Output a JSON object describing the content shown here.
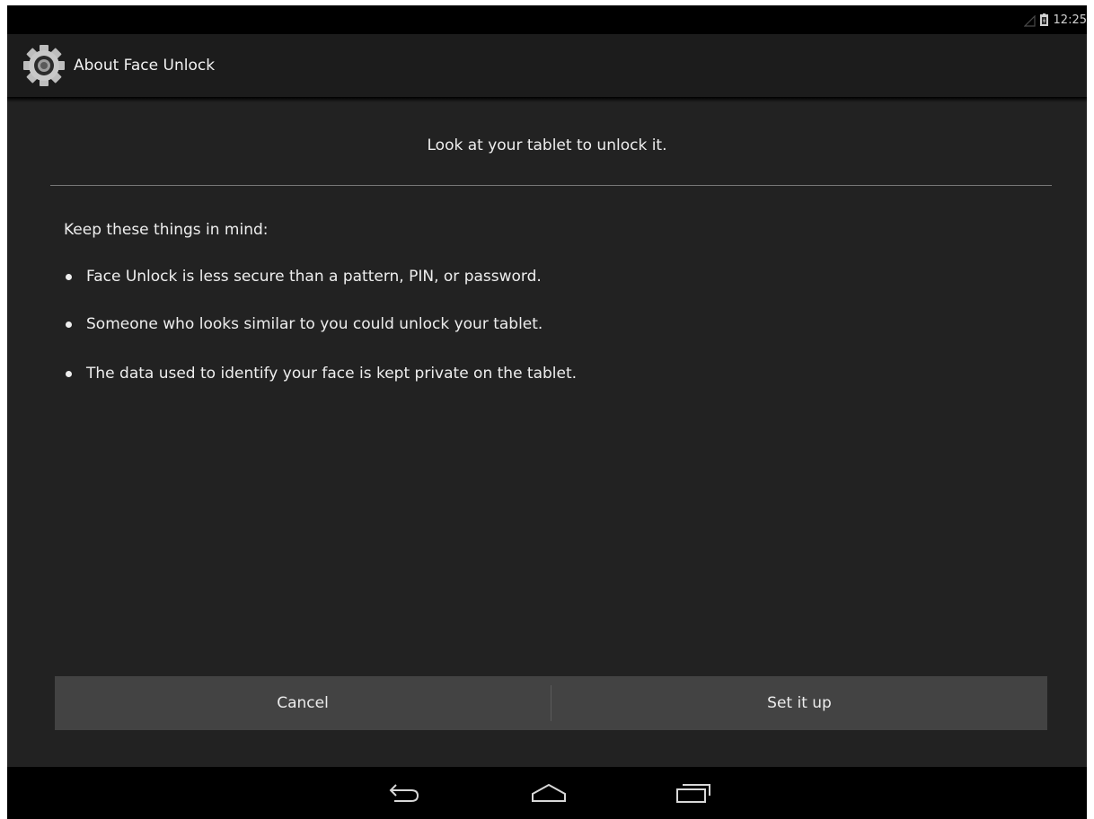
{
  "status_bar": {
    "time": "12:25",
    "icons": [
      "signal-icon",
      "battery-icon"
    ]
  },
  "action_bar": {
    "icon": "settings-gear-icon",
    "title": "About Face Unlock"
  },
  "content": {
    "heading": "Look at your tablet to unlock it.",
    "intro": "Keep these things in mind:",
    "bullets": [
      "Face Unlock is less secure than a pattern, PIN, or password.",
      "Someone who looks similar to you could unlock your tablet.",
      "The data used to identify your face is kept private on the tablet."
    ]
  },
  "buttons": {
    "cancel": "Cancel",
    "setup": "Set it up"
  },
  "nav_bar": {
    "icons": [
      "back-icon",
      "home-icon",
      "recent-apps-icon"
    ]
  },
  "colors": {
    "background": "#222222",
    "action_bar": "#1c1c1c",
    "button_bar": "#434343",
    "text": "#eeeeee"
  }
}
